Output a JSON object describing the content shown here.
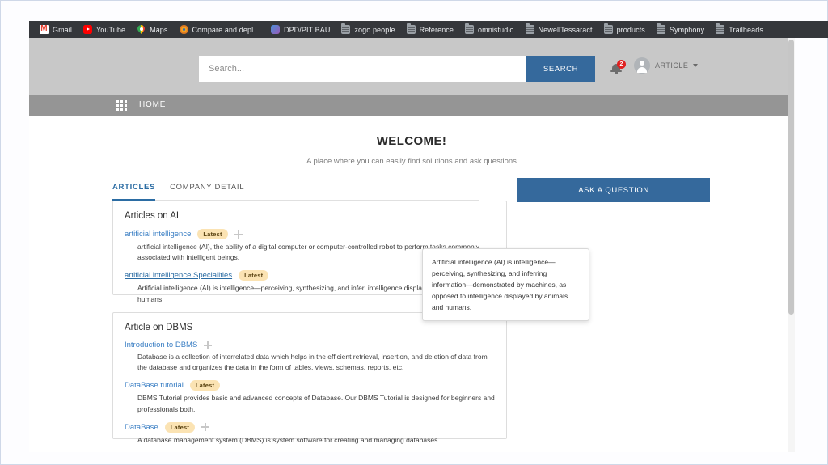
{
  "browser": {
    "bookmarks": [
      {
        "label": "Gmail",
        "icon": "gmail-icon"
      },
      {
        "label": "YouTube",
        "icon": "youtube-icon"
      },
      {
        "label": "Maps",
        "icon": "maps-pin-icon"
      },
      {
        "label": "Compare and depl...",
        "icon": "circle-icon"
      },
      {
        "label": "DPD/PIT BAU",
        "icon": "cloud-icon"
      },
      {
        "label": "zogo people",
        "icon": "folder-icon"
      },
      {
        "label": "Reference",
        "icon": "folder-icon"
      },
      {
        "label": "omnistudio",
        "icon": "folder-icon"
      },
      {
        "label": "NewellTessaract",
        "icon": "folder-icon"
      },
      {
        "label": "products",
        "icon": "folder-icon"
      },
      {
        "label": "Symphony",
        "icon": "folder-icon"
      },
      {
        "label": "Trailheads",
        "icon": "folder-icon"
      }
    ]
  },
  "header": {
    "search": {
      "placeholder": "Search...",
      "value": "",
      "button_label": "SEARCH"
    },
    "notifications": {
      "icon": "bell-icon",
      "count": "2"
    },
    "account": {
      "avatar_icon": "user-avatar-icon",
      "name": "ARTICLE",
      "caret_icon": "chevron-down-icon"
    }
  },
  "nav": {
    "app_launcher_icon": "grid-waffle-icon",
    "home_label": "HOME"
  },
  "welcome": {
    "title": "WELCOME!",
    "subtitle": "A place where you can easily find solutions and ask questions"
  },
  "tabs": [
    {
      "label": "ARTICLES",
      "active": true
    },
    {
      "label": "COMPANY DETAIL",
      "active": false
    }
  ],
  "ask_button": {
    "label": "ASK A QUESTION"
  },
  "cards": [
    {
      "title": "Articles on AI",
      "articles": [
        {
          "link": "artificial intelligence",
          "badge": "Latest",
          "has_flake": true,
          "hovered": false,
          "description": "artificial intelligence (AI), the ability of a digital computer or computer-controlled robot to perform tasks commonly associated with intelligent beings."
        },
        {
          "link": "artificial intelligence Specialities",
          "badge": "Latest",
          "has_flake": false,
          "hovered": true,
          "description": "Artificial intelligence (AI) is intelligence—perceiving, synthesizing, and infer. intelligence displayed by animals and humans."
        }
      ]
    },
    {
      "title": "Article on DBMS",
      "articles": [
        {
          "link": "Introduction to DBMS",
          "badge": "",
          "has_flake": true,
          "hovered": false,
          "description": "Database is a collection of interrelated data which helps in the efficient retrieval, insertion, and deletion of data from the database and organizes the data in the form of tables, views, schemas, reports, etc."
        },
        {
          "link": "DataBase tutorial",
          "badge": "Latest",
          "has_flake": false,
          "hovered": false,
          "description": "DBMS Tutorial provides basic and advanced concepts of Database. Our DBMS Tutorial is designed for beginners and professionals both."
        },
        {
          "link": "DataBase",
          "badge": "Latest",
          "has_flake": true,
          "hovered": false,
          "description": "A database management system (DBMS) is system software for creating and managing databases."
        }
      ]
    }
  ],
  "tooltip": {
    "text": "Artificial intelligence (AI) is intelligence—perceiving, synthesizing, and inferring information—demonstrated by machines, as opposed to intelligence displayed by animals and humans."
  },
  "colors": {
    "accent_blue": "#35699c",
    "link_blue": "#3b7fc4",
    "badge_red": "#e02020",
    "pill_yellow": "#fbe3b3",
    "bookmark_bar": "#35373b",
    "header_gray": "#c8c8c8",
    "nav_gray": "#959595"
  }
}
